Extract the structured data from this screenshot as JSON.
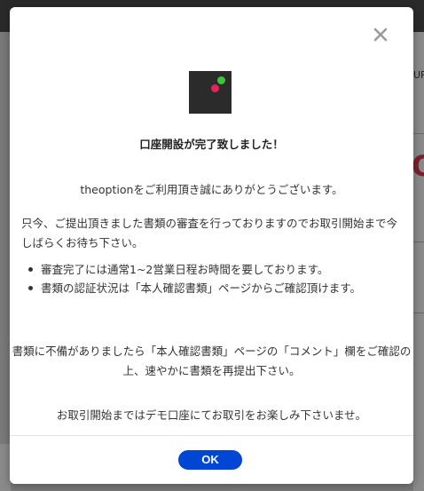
{
  "background": {
    "side_text_top": "UP",
    "side_text_large": "O"
  },
  "modal": {
    "close_icon": "close-icon",
    "logo_icon": "theoption-logo",
    "title": "口座開設が完了致しました！",
    "thanks": "theoptionをご利用頂き誠にありがとうございます。",
    "review_notice": "只今、ご提出頂きました書類の審査を行っておりますのでお取引開始まで今しばらくお待ち下さい。",
    "bullets": [
      "審査完了には通常1~2営業日程お時間を要しております。",
      "書類の認証状況は「本人確認書類」ページからご確認頂けます。"
    ],
    "docs_notice": "書類に不備がありましたら「本人確認書類」ページの「コメント」欄をご確認の上、速やかに書類を再提出下さい。",
    "demo_notice": "お取引開始まではデモ口座にてお取引をお楽しみ下さいませ。",
    "ok_label": "OK"
  },
  "colors": {
    "accent": "#0046d5",
    "logo_green": "#3cc63c",
    "logo_red": "#e0245e",
    "logo_bg": "#2b2b2b"
  }
}
